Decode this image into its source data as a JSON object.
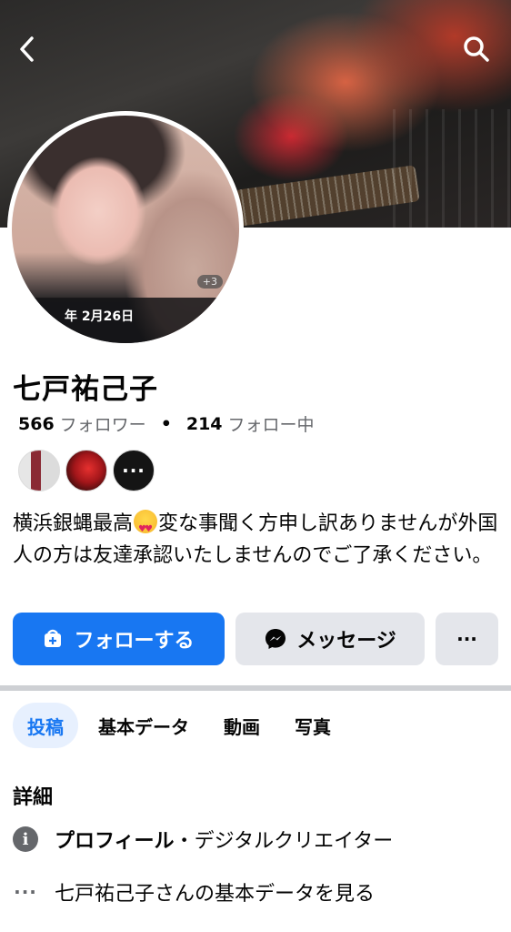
{
  "profile": {
    "name": "七戸祐己子",
    "avatar_date": "年 2月26日",
    "avatar_plus": "+3",
    "followers_count": "566",
    "followers_label": "フォロワー",
    "separator": "•",
    "following_count": "214",
    "following_label": "フォロー中",
    "bio_part1": "横浜銀蝿最高",
    "bio_part2": "変な事聞く方申し訳ありませんが外国人の方は友達承認いたしませんのでご了承ください。",
    "friends_more": "···"
  },
  "actions": {
    "follow_label": "フォローする",
    "message_label": "メッセージ",
    "more_label": "···"
  },
  "tabs": [
    {
      "label": "投稿",
      "active": true
    },
    {
      "label": "基本データ",
      "active": false
    },
    {
      "label": "動画",
      "active": false
    },
    {
      "label": "写真",
      "active": false
    }
  ],
  "details": {
    "title": "詳細",
    "profile_label": "プロフィール",
    "profile_value": "・デジタルクリエイター",
    "more_text": "七戸祐己子さんの基本データを見る"
  },
  "colors": {
    "accent": "#1877f2",
    "secondary_button": "#e4e6eb",
    "muted_text": "#65676b"
  }
}
